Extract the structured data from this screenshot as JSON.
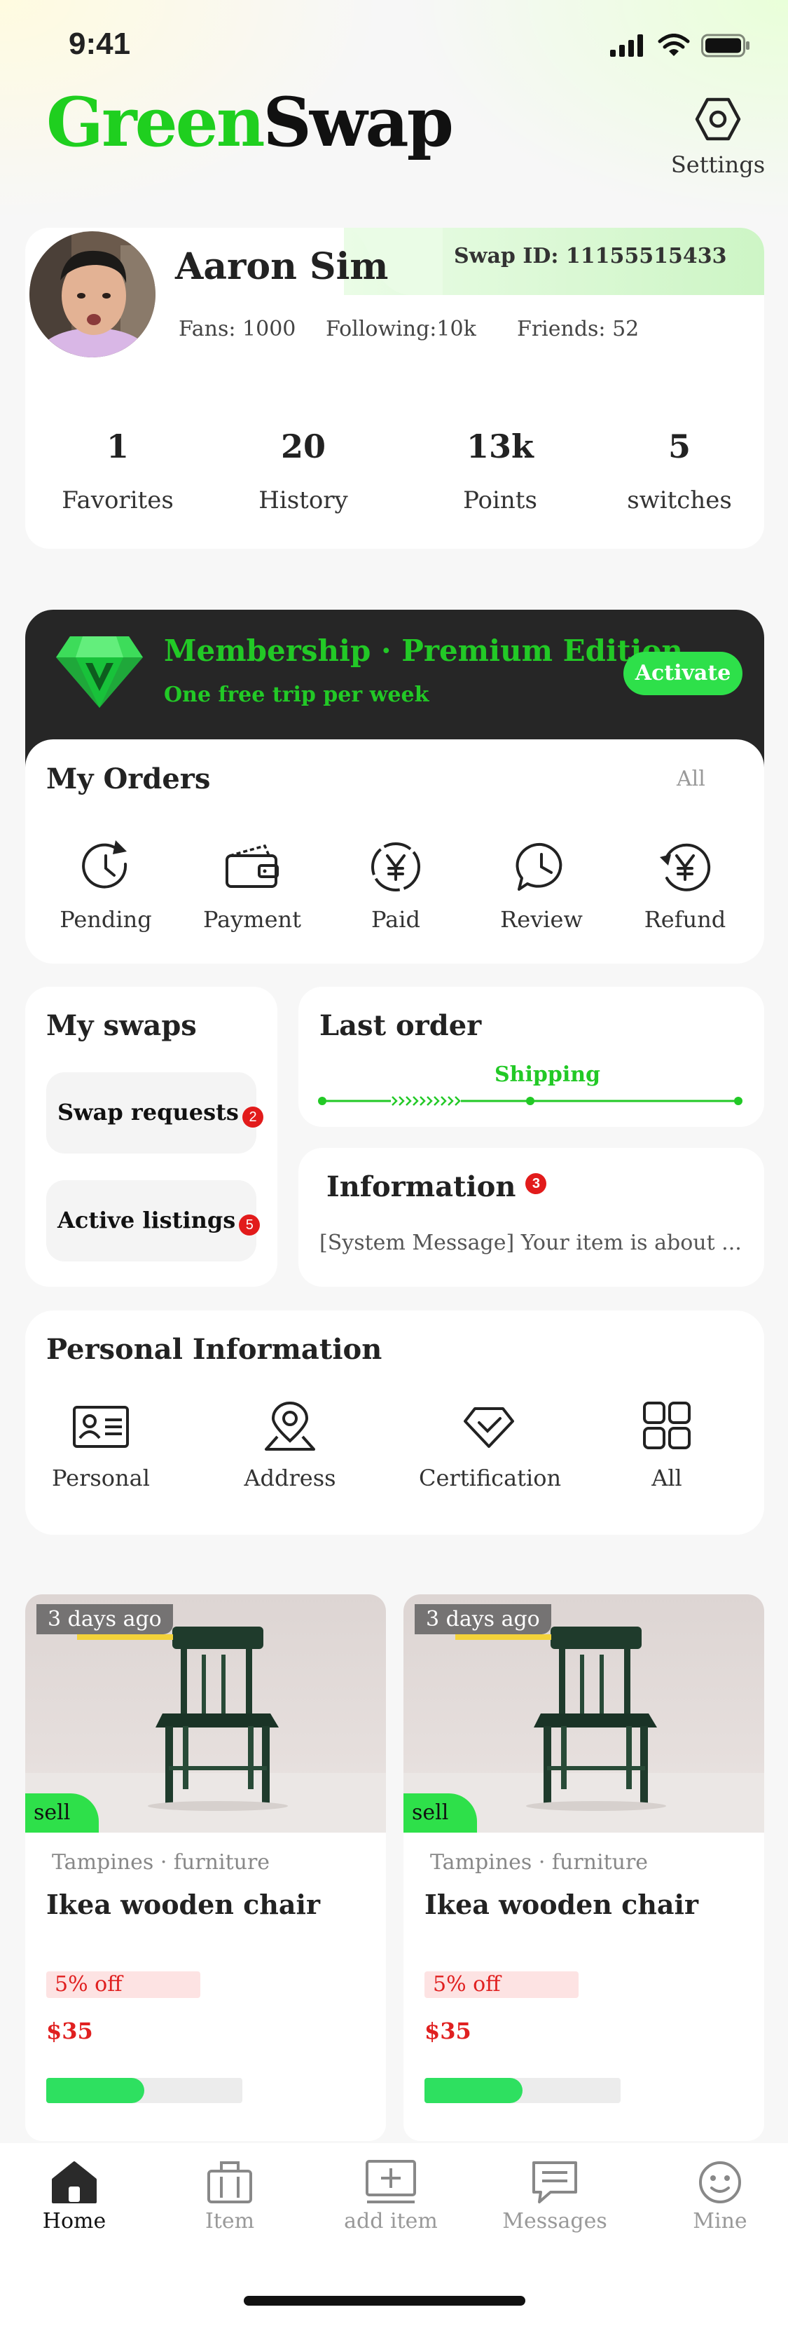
{
  "status_bar": {
    "time": "9:41"
  },
  "header": {
    "logo_green": "Green",
    "logo_black": "Swap",
    "settings_label": "Settings"
  },
  "profile": {
    "name": "Aaron Sim",
    "swap_id": "Swap ID: 11155515433",
    "fans": "Fans:  1000",
    "following": "Following:10k",
    "friends": "Friends: 52",
    "stats": [
      {
        "value": "1",
        "label": "Favorites"
      },
      {
        "value": "20",
        "label": "History"
      },
      {
        "value": "13k",
        "label": "Points"
      },
      {
        "value": "5",
        "label": "switches"
      }
    ]
  },
  "membership": {
    "title": "Membership · Premium Edition",
    "subtitle": "One free trip per week",
    "button": "Activate"
  },
  "orders": {
    "title": "My Orders",
    "all_link": "All",
    "items": [
      {
        "label": "Pending",
        "icon": "clock-arrow-icon"
      },
      {
        "label": "Payment",
        "icon": "wallet-icon"
      },
      {
        "label": "Paid",
        "icon": "yen-circle-icon"
      },
      {
        "label": "Review",
        "icon": "chat-clock-icon"
      },
      {
        "label": "Refund",
        "icon": "yen-refund-icon"
      }
    ]
  },
  "swaps": {
    "title": "My swaps",
    "requests_label": "Swap requests",
    "requests_count": "2",
    "listings_label": "Active listings",
    "listings_count": "5"
  },
  "last_order": {
    "title": "Last order",
    "status": "Shipping"
  },
  "information": {
    "title": "Information",
    "count": "3",
    "message": "[System Message] Your item is about ..."
  },
  "personal_info": {
    "title": "Personal Information",
    "items": [
      {
        "label": "Personal",
        "icon": "id-card-icon"
      },
      {
        "label": "Address",
        "icon": "location-pin-icon"
      },
      {
        "label": "Certification",
        "icon": "diamond-check-icon"
      },
      {
        "label": "All",
        "icon": "grid-icon"
      }
    ]
  },
  "products": [
    {
      "age": "3 days ago",
      "tag": "sell",
      "location": "Tampines · furniture",
      "title": "Ikea wooden chair",
      "discount": "5% off",
      "price": "$35",
      "progress": 0.5
    },
    {
      "age": "3 days ago",
      "tag": "sell",
      "location": "Tampines · furniture",
      "title": "Ikea wooden chair",
      "discount": "5% off",
      "price": "$35",
      "progress": 0.5
    }
  ],
  "tabbar": [
    {
      "label": "Home",
      "icon": "home-icon",
      "active": true
    },
    {
      "label": "Item",
      "icon": "bag-icon",
      "active": false
    },
    {
      "label": "add item",
      "icon": "add-square-icon",
      "active": false
    },
    {
      "label": "Messages",
      "icon": "message-icon",
      "active": false
    },
    {
      "label": "Mine",
      "icon": "smiley-icon",
      "active": false
    }
  ],
  "colors": {
    "brand_green": "#1fcf1f",
    "accent_green": "#2ee04a",
    "badge_red": "#e21b1b",
    "dark": "#262626"
  }
}
